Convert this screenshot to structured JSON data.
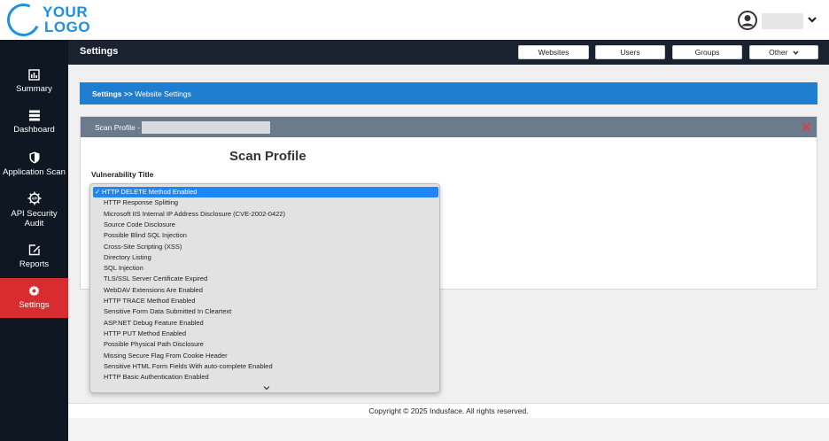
{
  "header": {
    "logo_line1": "YOUR",
    "logo_line2": "LOGO"
  },
  "sidebar": {
    "items": [
      {
        "label": "Summary",
        "icon": "chart-report-icon"
      },
      {
        "label": "Dashboard",
        "icon": "server-stack-icon"
      },
      {
        "label": "Application Scan",
        "icon": "shield-icon"
      },
      {
        "label": "API Security Audit",
        "icon": "api-gear-icon"
      },
      {
        "label": "Reports",
        "icon": "edit-report-icon"
      },
      {
        "label": "Settings",
        "icon": "gear-icon",
        "active": true
      }
    ]
  },
  "titlebar": {
    "title": "Settings",
    "buttons": [
      "Websites",
      "Users",
      "Groups",
      "Other"
    ]
  },
  "breadcrumb": {
    "root": "Settings",
    "separator": ">>",
    "current": "Website Settings"
  },
  "card": {
    "header_prefix": "Scan Profile -",
    "title": "Scan Profile",
    "field_label": "Vulnerability Title"
  },
  "dropdown": {
    "selected_index": 0,
    "options": [
      "HTTP DELETE Method Enabled",
      "HTTP Response Splitting",
      "Microsoft IIS Internal IP Address Disclosure (CVE-2002-0422)",
      "Source Code Disclosure",
      "Possible Blind SQL Injection",
      "Cross-Site Scripting (XSS)",
      "Directory Listing",
      "SQL Injection",
      "TLS/SSL Server Certificate Expired",
      "WebDAV Extensions Are Enabled",
      "HTTP TRACE Method Enabled",
      "Sensitive Form Data Submitted In Cleartext",
      "ASP.NET Debug Feature Enabled",
      "HTTP PUT Method Enabled",
      "Possible Physical Path Disclosure",
      "Missing Secure Flag From Cookie Header",
      "Sensitive HTML Form Fields With auto-complete Enabled",
      "HTTP Basic Authentication Enabled"
    ]
  },
  "footer": {
    "copyright": "Copyright © 2025 Indusface. All rights reserved."
  },
  "colors": {
    "accent_blue": "#1f7ecf",
    "sidebar_bg": "#0f1722",
    "active_red": "#d82c30",
    "selected_option": "#1f86f5"
  }
}
